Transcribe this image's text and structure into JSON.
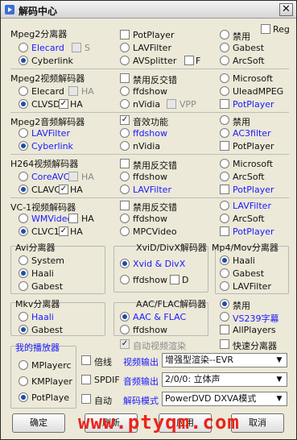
{
  "window": {
    "title": "解码中心",
    "close_glyph": "✕"
  },
  "top_reg": {
    "label": "Reg",
    "checked": false
  },
  "sections": {
    "mpeg2split": {
      "title": "Mpeg2分离器",
      "col1": [
        {
          "label": "Elecard",
          "on": false,
          "blue": true
        },
        {
          "label": "Cyberlink",
          "on": true,
          "blue": false
        }
      ],
      "s_label": "S",
      "col2": [
        {
          "label": "PotPlayer",
          "on": false
        },
        {
          "label": "LAVFilter",
          "on": false
        },
        {
          "label": "AVSplitter",
          "on": false
        }
      ],
      "f_label": "F",
      "col3": [
        {
          "label": "禁用",
          "on": false
        },
        {
          "label": "Gabest",
          "on": false
        },
        {
          "label": "ArcSoft",
          "on": false
        }
      ]
    },
    "mpeg2video": {
      "title": "Mpeg2视频解码器",
      "col1": [
        {
          "label": "Elecard",
          "on": false
        },
        {
          "label": "CLVSD",
          "on": true
        }
      ],
      "ha1": "HA",
      "ha2": "HA",
      "col2": [
        {
          "label": "禁用反交错",
          "on": false
        },
        {
          "label": "ffdshow",
          "on": false
        },
        {
          "label": "nVidia",
          "on": false
        }
      ],
      "vpp": "VPP",
      "col3": [
        {
          "label": "Microsoft",
          "on": false
        },
        {
          "label": "UleadMPEG",
          "on": false
        },
        {
          "label": "PotPlayer",
          "on": false
        }
      ]
    },
    "mpeg2audio": {
      "title": "Mpeg2音频解码器",
      "col1": [
        {
          "label": "LAVFilter",
          "on": false
        },
        {
          "label": "Cyberlink",
          "on": true
        }
      ],
      "col2": [
        {
          "label": "音效功能",
          "on": true
        },
        {
          "label": "ffdshow",
          "on": false
        },
        {
          "label": "nVidia",
          "on": false
        }
      ],
      "col3": [
        {
          "label": "禁用",
          "on": false
        },
        {
          "label": "AC3filter",
          "on": false
        },
        {
          "label": "PotPlayer",
          "on": false
        }
      ]
    },
    "h264": {
      "title": "H264视频解码器",
      "col1": [
        {
          "label": "CoreAVC",
          "on": false
        },
        {
          "label": "CLAVC",
          "on": true
        }
      ],
      "ha1": "HA",
      "ha2": "HA",
      "col2": [
        {
          "label": "禁用反交错",
          "on": false
        },
        {
          "label": "ffdshow",
          "on": false
        },
        {
          "label": "LAVFilter",
          "on": false
        }
      ],
      "col3": [
        {
          "label": "Microsoft",
          "on": false
        },
        {
          "label": "ArcSoft",
          "on": false
        },
        {
          "label": "PotPlayer",
          "on": false
        }
      ]
    },
    "vc1": {
      "title": "VC-1视频解码器",
      "col1": [
        {
          "label": "WMVideo",
          "on": false
        },
        {
          "label": "CLVC1",
          "on": true
        }
      ],
      "ha1": "HA",
      "ha2": "HA",
      "col2": [
        {
          "label": "禁用反交错",
          "on": false
        },
        {
          "label": "ffdshow",
          "on": false
        },
        {
          "label": "MPCVideo",
          "on": false
        }
      ],
      "col3": [
        {
          "label": "LAVFilter",
          "on": false
        },
        {
          "label": "ArcSoft",
          "on": false
        },
        {
          "label": "PotPlayer",
          "on": false
        }
      ]
    },
    "avi": {
      "title": "Avi分离器",
      "items": [
        {
          "label": "System",
          "on": false
        },
        {
          "label": "Haali",
          "on": true
        },
        {
          "label": "Gabest",
          "on": false
        }
      ]
    },
    "xvid": {
      "title": "XviD/DivX解码器",
      "items": [
        {
          "label": "Xvid & DivX",
          "on": true
        },
        {
          "label": "ffdshow",
          "on": false
        }
      ],
      "d_label": "D"
    },
    "mp4": {
      "title": "Mp4/Mov分离器",
      "items": [
        {
          "label": "Haali",
          "on": true
        },
        {
          "label": "Gabest",
          "on": false
        },
        {
          "label": "LAVFilter",
          "on": false
        }
      ]
    },
    "mkv": {
      "title": "Mkv分离器",
      "items": [
        {
          "label": "Haali",
          "on": false
        },
        {
          "label": "Gabest",
          "on": true
        }
      ]
    },
    "aac": {
      "title": "AAC/FLAC解码器",
      "items": [
        {
          "label": "AAC & FLAC",
          "on": true
        },
        {
          "label": "ffdshow",
          "on": false
        }
      ]
    },
    "misc": {
      "items": [
        {
          "label": "禁用",
          "on": true
        },
        {
          "label": "VS239字幕",
          "on": false
        }
      ],
      "allplayers": "AllPlayers"
    }
  },
  "auto_render": "自动视频渲染",
  "quick_split": "快速分离器",
  "my_player": {
    "title": "我的播放器",
    "items": [
      {
        "label": "MPlayerc",
        "on": false
      },
      {
        "label": "KMPlayer",
        "on": false
      },
      {
        "label": "PotPlaye",
        "on": true
      }
    ]
  },
  "options": {
    "rows": [
      {
        "check": "倍线",
        "label": "视频输出",
        "value": "增强型渲染--EVR"
      },
      {
        "check": "SPDIF",
        "label": "音频输出",
        "value": "2/0/0: 立体声"
      },
      {
        "check": "自动",
        "label": "解码模式",
        "value": "PowerDVD DXVA模式"
      }
    ]
  },
  "buttons": {
    "ok": "确定",
    "refresh": "刷新",
    "apply": "应用",
    "cancel": "取消"
  },
  "watermark": "www.ptyqm.com"
}
